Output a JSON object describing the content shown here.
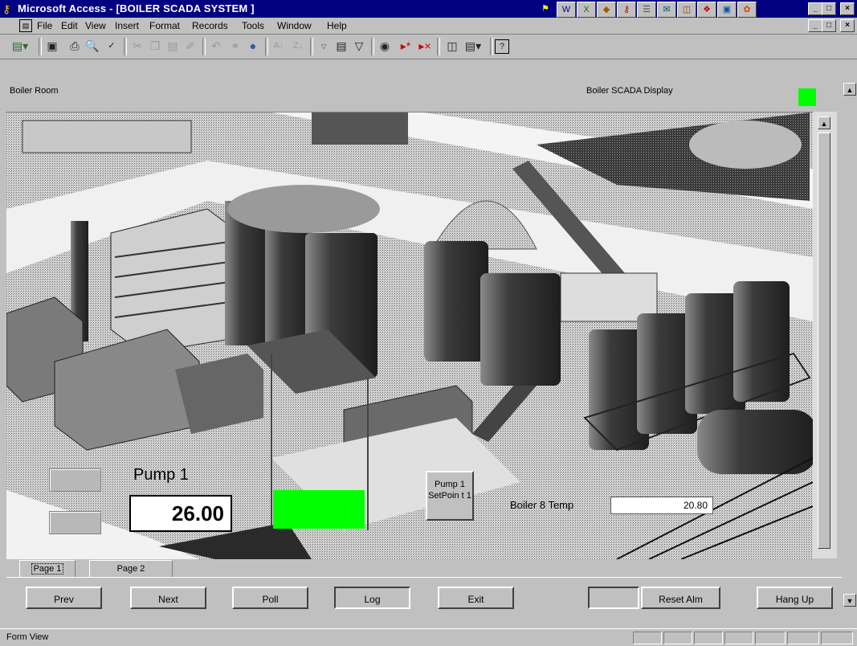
{
  "window": {
    "title": "Microsoft Access - [BOILER SCADA SYSTEM ]",
    "controls": [
      "minimize-icon",
      "maximize-icon",
      "close-icon"
    ]
  },
  "menu": {
    "items": [
      "File",
      "Edit",
      "View",
      "Insert",
      "Format",
      "Records",
      "Tools",
      "Window",
      "Help"
    ]
  },
  "toolbar": {
    "icons": [
      "view-icon",
      "save-icon",
      "print-icon",
      "print-preview-icon",
      "spelling-icon",
      "cut-icon",
      "copy-icon",
      "paste-icon",
      "format-painter-icon",
      "undo-icon",
      "hyperlink-icon",
      "web-icon",
      "sort-ascending-icon",
      "sort-descending-icon",
      "filter-by-selection-icon",
      "filter-by-form-icon",
      "apply-filter-icon",
      "find-icon",
      "new-record-icon",
      "delete-record-icon",
      "database-window-icon",
      "new-object-icon",
      "help-icon"
    ]
  },
  "header": {
    "left_label": "Boiler Room",
    "right_label": "Boiler SCADA Display",
    "indicator_color": "#00ff00"
  },
  "scada": {
    "pump_label": "Pump 1",
    "pump_value": "26.00",
    "pump_status_color": "#00ff00",
    "setpoint_button": "Pump 1 SetPoin t 1",
    "temp_label": "Boiler 8 Temp",
    "temp_value": "20.80"
  },
  "tabs": [
    "Page 1",
    "Page 2"
  ],
  "buttons": {
    "prev": "Prev",
    "next": "Next",
    "poll": "Poll",
    "log": "Log",
    "exit": "Exit",
    "reset": "Reset Alm",
    "hangup": "Hang Up"
  },
  "status": {
    "text": "Form View"
  }
}
